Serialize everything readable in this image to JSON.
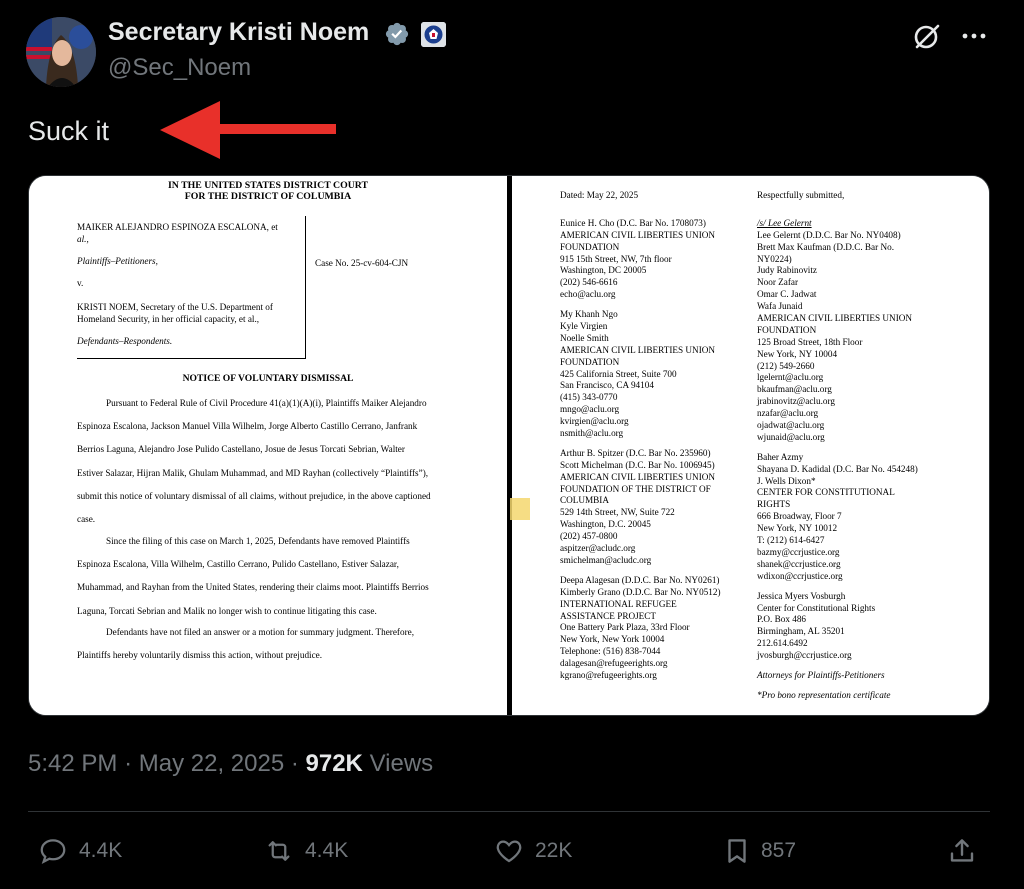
{
  "author": {
    "name": "Secretary Kristi Noem",
    "handle": "@Sec_Noem"
  },
  "tweet": {
    "text": "Suck it"
  },
  "document_left": {
    "court_line1": "IN THE UNITED STATES DISTRICT COURT",
    "court_line2": "FOR THE DISTRICT OF COLUMBIA",
    "caption_petitioner": "MAIKER ALEJANDRO ESPINOZA ESCALONA, et",
    "caption_petitioner2": "al.,",
    "caption_role1": "Plaintiffs–Petitioners,",
    "caption_v": "v.",
    "caption_respondent": "KRISTI NOEM, Secretary of the U.S. Department of",
    "caption_respondent2": "Homeland Security, in her official capacity, et al.,",
    "caption_role2": "Defendants–Respondents.",
    "case_no": "Case No. 25-cv-604-CJN",
    "notice_title": "NOTICE OF VOLUNTARY DISMISSAL",
    "para1": [
      "Pursuant to Federal Rule of Civil Procedure 41(a)(1)(A)(i), Plaintiffs Maiker Alejandro",
      "Espinoza Escalona, Jackson Manuel Villa Wilhelm, Jorge Alberto Castillo Cerrano, Janfrank",
      "Berrios Laguna, Alejandro Jose Pulido Castellano, Josue de Jesus Torcati Sebrian, Walter",
      "Estiver Salazar, Hijran Malik, Ghulam Muhammad, and MD Rayhan (collectively “Plaintiffs”),",
      "submit this notice of voluntary dismissal of all claims, without prejudice, in the above captioned",
      "case."
    ],
    "para2": [
      "Since the filing of this case on March 1, 2025, Defendants have removed Plaintiffs",
      "Espinoza Escalona, Villa Wilhelm, Castillo Cerrano, Pulido Castellano, Estiver Salazar,",
      "Muhammad, and Rayhan from the United States, rendering their claims moot. Plaintiffs Berrios",
      "Laguna, Torcati Sebrian and Malik no longer wish to continue litigating this case."
    ],
    "para3": [
      "Defendants have not filed an answer or a motion for summary judgment. Therefore,",
      "Plaintiffs hereby voluntarily dismiss this action, without prejudice."
    ]
  },
  "document_right": {
    "left_col": [
      "Dated: May 22, 2025",
      "",
      "",
      "Eunice H. Cho (D.C. Bar No. 1708073)",
      "AMERICAN CIVIL LIBERTIES UNION",
      "FOUNDATION",
      "915 15th Street, NW, 7th floor",
      "Washington, DC 20005",
      "(202) 546-6616",
      "echo@aclu.org",
      "",
      "My Khanh Ngo",
      "Kyle Virgien",
      "Noelle Smith",
      "AMERICAN CIVIL LIBERTIES UNION",
      "FOUNDATION",
      "425 California Street, Suite 700",
      "San Francisco, CA 94104",
      "(415) 343-0770",
      "mngo@aclu.org",
      "kvirgien@aclu.org",
      "nsmith@aclu.org",
      "",
      "Arthur B. Spitzer (D.C. Bar No. 235960)",
      "Scott Michelman (D.C. Bar No. 1006945)",
      "AMERICAN CIVIL LIBERTIES UNION",
      "FOUNDATION OF THE DISTRICT OF",
      "COLUMBIA",
      "529 14th Street, NW, Suite 722",
      "Washington, D.C. 20045",
      "(202) 457-0800",
      "aspitzer@acludc.org",
      "smichelman@acludc.org",
      "",
      "Deepa Alagesan (D.D.C. Bar No. NY0261)",
      "Kimberly Grano (D.D.C. Bar No. NY0512)",
      "INTERNATIONAL REFUGEE",
      "ASSISTANCE PROJECT",
      "One Battery Park Plaza, 33rd Floor",
      "New York, New York 10004",
      "Telephone: (516) 838-7044",
      "dalagesan@refugeerights.org",
      "kgrano@refugeerights.org"
    ],
    "right_col": [
      "Respectfully submitted,",
      "",
      "",
      "/s/ Lee Gelernt",
      "Lee Gelernt (D.D.C. Bar No. NY0408)",
      "Brett Max Kaufman (D.D.C. Bar No.",
      "NY0224)",
      "Judy Rabinovitz",
      "Noor Zafar",
      "Omar C. Jadwat",
      "Wafa Junaid",
      "AMERICAN CIVIL LIBERTIES UNION",
      "FOUNDATION",
      "125 Broad Street, 18th Floor",
      "New York, NY 10004",
      "(212) 549-2660",
      "lgelernt@aclu.org",
      "bkaufman@aclu.org",
      "jrabinovitz@aclu.org",
      "nzafar@aclu.org",
      "ojadwat@aclu.org",
      "wjunaid@aclu.org",
      "",
      "Baher Azmy",
      "Shayana D. Kadidal (D.C. Bar No. 454248)",
      "J. Wells Dixon*",
      "CENTER FOR CONSTITUTIONAL",
      "RIGHTS",
      "666 Broadway, Floor 7",
      "New York, NY 10012",
      "T: (212) 614-6427",
      "bazmy@ccrjustice.org",
      "shanek@ccrjustice.org",
      "wdixon@ccrjustice.org",
      "",
      "Jessica Myers Vosburgh",
      "Center for Constitutional Rights",
      "P.O. Box 486",
      "Birmingham, AL 35201",
      "212.614.6492",
      "jvosburgh@ccrjustice.org",
      "",
      "Attorneys for Plaintiffs-Petitioners",
      "",
      "*Pro bono representation certificate"
    ]
  },
  "meta": {
    "time": "5:42 PM",
    "dot": "·",
    "date": "May 22, 2025",
    "dot2": "·",
    "views_count": "972K",
    "views_label": "Views"
  },
  "actions": {
    "replies": "4.4K",
    "reposts": "4.4K",
    "likes": "22K",
    "bookmarks": "857"
  },
  "colors": {
    "background": "#000000",
    "text": "#e7e9ea",
    "muted": "#71767b",
    "verified": "#829aab",
    "arrow": "#e8302a"
  }
}
